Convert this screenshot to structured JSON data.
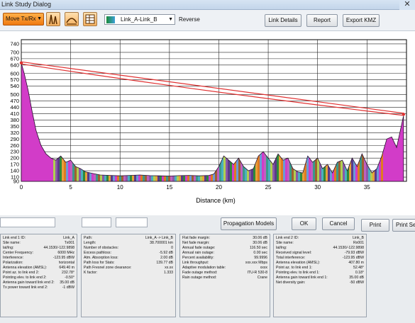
{
  "window": {
    "title": "Link Study Dialog",
    "close_glyph": "✕"
  },
  "toolbar": {
    "move_button": "Move Tx/Rx",
    "link_select": "Link_A-Link_B",
    "reverse_label": "Reverse",
    "link_details": "Link Details",
    "report": "Report",
    "export_kmz": "Export KMZ",
    "icons": [
      "towers-icon",
      "path-profile-icon",
      "table-icon",
      "terrain-icon"
    ]
  },
  "chart_data": {
    "type": "area",
    "xlabel": "Distance (km)",
    "ylabel": "",
    "xlim": [
      0,
      39
    ],
    "ylim": [
      90,
      760
    ],
    "x_ticks": [
      0,
      5,
      10,
      15,
      20,
      25,
      30,
      35
    ],
    "y_ticks": [
      90,
      110,
      140,
      170,
      200,
      230,
      260,
      290,
      320,
      350,
      380,
      410,
      440,
      470,
      500,
      540,
      570,
      600,
      640,
      670,
      700,
      740
    ],
    "grid": true,
    "line_of_sight": {
      "start": [
        0,
        650
      ],
      "end": [
        38.7,
        407
      ],
      "color": "#e03030"
    },
    "terrain": {
      "x": [
        0,
        0.3,
        0.7,
        1.1,
        1.5,
        2.0,
        2.5,
        3.0,
        3.5,
        4.0,
        4.5,
        5.0,
        5.5,
        6.0,
        6.5,
        7.0,
        7.5,
        8.0,
        9.0,
        10.0,
        11.0,
        12.0,
        13.0,
        14.0,
        15.0,
        16.0,
        17.0,
        18.0,
        19.0,
        19.5,
        20.0,
        20.5,
        21.0,
        21.5,
        22.0,
        22.5,
        23.0,
        23.5,
        24.0,
        24.5,
        25.0,
        25.5,
        26.0,
        26.5,
        27.0,
        27.5,
        28.0,
        28.5,
        29.0,
        29.5,
        30.0,
        30.5,
        31.0,
        31.5,
        32.0,
        32.5,
        33.0,
        33.5,
        34.0,
        34.5,
        35.0,
        35.5,
        36.0,
        36.5,
        37.0,
        37.5,
        38.0,
        38.7
      ],
      "y": [
        649,
        600,
        520,
        420,
        330,
        260,
        220,
        200,
        190,
        210,
        180,
        190,
        160,
        150,
        135,
        130,
        125,
        120,
        118,
        116,
        118,
        120,
        117,
        116,
        115,
        117,
        118,
        116,
        118,
        125,
        160,
        210,
        190,
        170,
        200,
        160,
        140,
        150,
        210,
        230,
        200,
        170,
        220,
        190,
        200,
        150,
        135,
        130,
        210,
        180,
        200,
        150,
        170,
        130,
        180,
        190,
        140,
        200,
        160,
        220,
        170,
        130,
        150,
        210,
        290,
        300,
        250,
        400
      ]
    }
  },
  "buttons": {
    "propagation_models": "Propagation Models",
    "ok": "OK",
    "cancel": "Cancel",
    "print": "Print",
    "print_setup": "Print Se"
  },
  "panels": [
    {
      "rows": [
        [
          "Link end 1 ID:",
          "Link_A"
        ],
        [
          "Site name:",
          "Tx001"
        ],
        [
          "lat/lng:",
          "44.1530/-122.9898"
        ],
        [
          "Center Frequency:",
          "6000 MHz"
        ],
        [
          "Interference:",
          "-123.95 dBW"
        ],
        [
          "Polarization:",
          "horizontal"
        ],
        [
          "Antenna elevation (AMSL):",
          "649.40 m"
        ],
        [
          "Point az. to link end 2:",
          "232.78°"
        ],
        [
          "Pointing elev. to link end 2:",
          "-0.50°"
        ],
        [
          "Antenna gain toward link end 2:",
          "35.00 dB"
        ],
        [
          "Tx power toward link end 2:",
          "-1 dBW"
        ]
      ]
    },
    {
      "rows": [
        [
          "Path:",
          "Link_A -> Link_B"
        ],
        [
          "Length:",
          "38.700001 km"
        ],
        [
          "Number of obstacles:",
          "0"
        ],
        [
          "Excess pathloss:",
          "-5.92 dB"
        ],
        [
          "Atm. Absorption loss:",
          "2.00 dB"
        ],
        [
          "Path loss for Stats:",
          "139.77 dB"
        ],
        [
          "Path Fresnel zone clearance:",
          "xx.xx"
        ],
        [
          "K factor:",
          "1.333"
        ]
      ]
    },
    {
      "rows": [
        [
          "Flat fade margin:",
          "30.06 dB"
        ],
        [
          "Net fade margin:",
          "30.06 dB"
        ],
        [
          "Annual fade outage:",
          "116.50 sec"
        ],
        [
          "Annual rain outage:",
          "0.00 sec"
        ],
        [
          "Percent availability:",
          "99.9996"
        ],
        [
          "Link throughput:",
          "xxx.xxx Mbps"
        ],
        [
          "Adaptive modulation table:",
          "xxxx"
        ],
        [
          "Fade outage method:",
          "ITU-R 530-8"
        ],
        [
          "Rain outage method:",
          "Crane"
        ]
      ]
    },
    {
      "rows": [
        [
          "Link end 2 ID:",
          "Link_B"
        ],
        [
          "Site name:",
          "Rx001"
        ],
        [
          "lat/lng:",
          "44.1530/-122.9898"
        ],
        [
          "Received signal level:",
          "-79.93 dBW"
        ],
        [
          "Total interference:",
          "-123.95 dBW"
        ],
        [
          "Antenna elevation (AMSL):",
          "407.80 m"
        ],
        [
          "Point az. to link end 1:",
          "52.48°"
        ],
        [
          "Pointing elev. to link end 1:",
          "0.18°"
        ],
        [
          "Antenna gain toward link end 1:",
          "35.00 dB"
        ],
        [
          "Net diversity gain:",
          "-50 dBW"
        ]
      ]
    }
  ]
}
